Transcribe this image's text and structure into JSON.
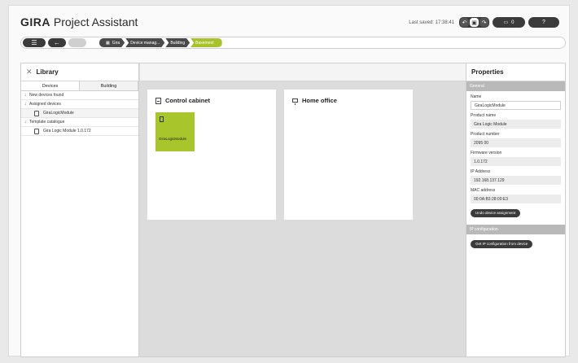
{
  "app": {
    "brand": "GIRA",
    "product": "Project Assistant"
  },
  "header": {
    "last_saved_label": "Last saved:",
    "last_saved_time": "17:38:41",
    "chat_count": "0",
    "help_label": "?"
  },
  "breadcrumb": [
    "Gira",
    "Device manag...",
    "Building",
    "Basement"
  ],
  "library": {
    "title": "Library",
    "tabs": [
      "Devices",
      "Building"
    ],
    "tree": [
      {
        "label": "New devices found",
        "type": "group"
      },
      {
        "label": "Assigned devices",
        "type": "group"
      },
      {
        "label": "GiraLogicModule",
        "type": "device"
      },
      {
        "label": "Template catalogue",
        "type": "group"
      },
      {
        "label": "Gira Logic Module 1.0.172",
        "type": "device"
      }
    ]
  },
  "rooms": [
    {
      "title": "Control cabinet",
      "icon": "cabinet-icon",
      "device": "GiraLogicModule"
    },
    {
      "title": "Home office",
      "icon": "monitor-icon"
    }
  ],
  "properties": {
    "title": "Properties",
    "general_label": "General",
    "fields": [
      {
        "label": "Name",
        "value": "GiraLogicModule"
      },
      {
        "label": "Product name",
        "value": "Gira Logic Module"
      },
      {
        "label": "Product number",
        "value": "2095 00"
      },
      {
        "label": "Firmware version",
        "value": "1.0.172"
      },
      {
        "label": "IP Address",
        "value": "192.168.137.129"
      },
      {
        "label": "MAC address",
        "value": "00:0A:B3:28:00:E3"
      }
    ],
    "undo_button": "Undo device assignment",
    "ip_section_label": "IP configuration",
    "ip_button": "Get IP configuration from device"
  },
  "colors": {
    "accent": "#a8c62b",
    "dark": "#3b3b3b",
    "section": "#b9b9b9"
  }
}
